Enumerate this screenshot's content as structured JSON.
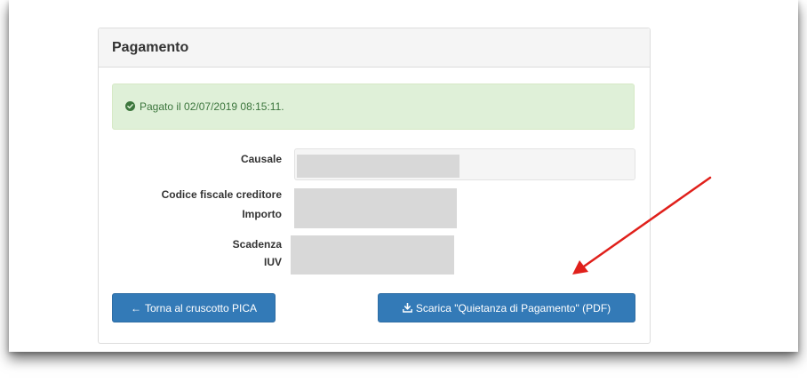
{
  "panel": {
    "title": "Pagamento"
  },
  "alert": {
    "icon": "check-circle-icon",
    "text": "Pagato il 02/07/2019 08:15:11."
  },
  "fields": {
    "causale": "Causale",
    "codice_fiscale": "Codice fiscale creditore",
    "importo": "Importo",
    "scadenza": "Scadenza",
    "iuv": "IUV"
  },
  "buttons": {
    "back_label": "Torna al cruscotto PICA",
    "back_icon": "arrow-left-icon",
    "download_label": "Scarica \"Quietanza di Pagamento\" (PDF)",
    "download_icon": "download-icon"
  },
  "colors": {
    "primary": "#337ab7",
    "success_bg": "#dff0d8",
    "success_text": "#3c763d",
    "annotation_arrow": "#e0201b"
  }
}
